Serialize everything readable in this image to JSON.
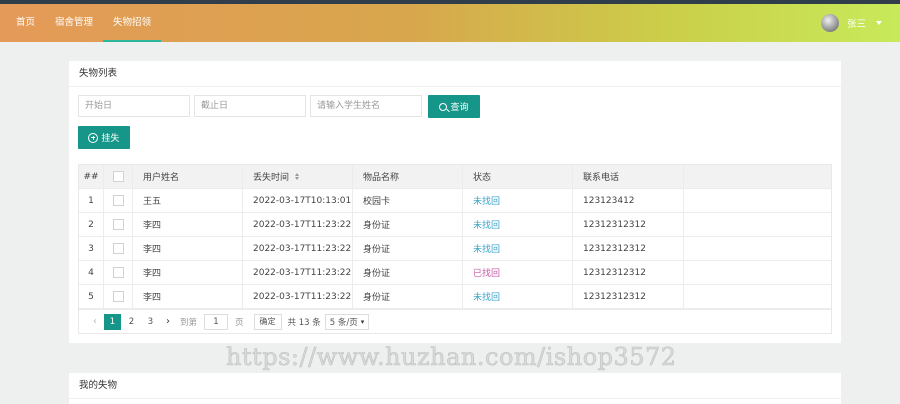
{
  "nav": {
    "items": [
      {
        "label": "首页",
        "active": false
      },
      {
        "label": "宿舍管理",
        "active": false
      },
      {
        "label": "失物招领",
        "active": true
      }
    ],
    "user_name": "张三"
  },
  "list_card": {
    "title": "失物列表",
    "filters": {
      "start_placeholder": "开始日",
      "end_placeholder": "截止日",
      "name_placeholder": "请输入学生姓名",
      "search_label": "查询"
    },
    "add_label": "挂失",
    "table": {
      "headers": {
        "index": "##",
        "name": "用户姓名",
        "time": "丢失时间",
        "item": "物品名称",
        "status": "状态",
        "phone": "联系电话"
      },
      "rows": [
        {
          "index": "1",
          "name": "王五",
          "time": "2022-03-17T10:13:01...",
          "item": "校园卡",
          "status": "未找回",
          "phone": "123123412"
        },
        {
          "index": "2",
          "name": "李四",
          "time": "2022-03-17T11:23:22...",
          "item": "身份证",
          "status": "未找回",
          "phone": "12312312312"
        },
        {
          "index": "3",
          "name": "李四",
          "time": "2022-03-17T11:23:22...",
          "item": "身份证",
          "status": "未找回",
          "phone": "12312312312"
        },
        {
          "index": "4",
          "name": "李四",
          "time": "2022-03-17T11:23:22...",
          "item": "身份证",
          "status": "已找回",
          "phone": "12312312312"
        },
        {
          "index": "5",
          "name": "李四",
          "time": "2022-03-17T11:23:22...",
          "item": "身份证",
          "status": "未找回",
          "phone": "12312312312"
        }
      ]
    },
    "pager": {
      "pages": [
        "1",
        "2",
        "3"
      ],
      "current": "1",
      "goto_label": "到第",
      "goto_value": "1",
      "page_unit": "页",
      "confirm_label": "确定",
      "total_label": "共 13 条",
      "page_size_label": "5 条/页"
    }
  },
  "my_card": {
    "title": "我的失物"
  },
  "watermark": "https://www.huzhan.com/ishop3572",
  "colors": {
    "primary": "#159688",
    "status_not_found": "#3aa0c8",
    "status_found": "#c55aa5"
  }
}
